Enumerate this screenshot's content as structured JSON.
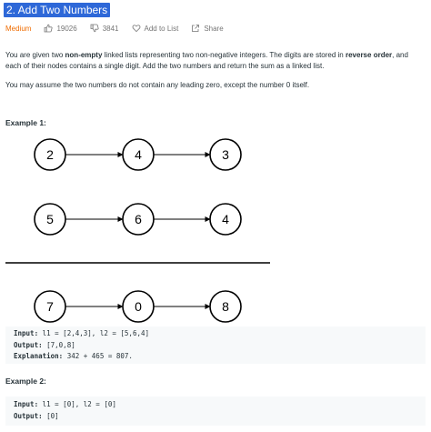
{
  "problem": {
    "title": "2. Add Two Numbers",
    "difficulty": "Medium",
    "likes": "19026",
    "dislikes": "3841",
    "add_to_list": "Add to List",
    "share": "Share"
  },
  "description": {
    "p1_before_bold1": "You are given two ",
    "p1_bold1": "non-empty",
    "p1_mid": " linked lists representing two non-negative integers. The digits are stored in ",
    "p1_bold2a": "reverse",
    "p1_bold2b": "order",
    "p1_end": ", and each of their nodes contains a single digit. Add the two numbers and return the sum as a linked list.",
    "p2": "You may assume the two numbers do not contain any leading zero, except the number 0 itself."
  },
  "example1": {
    "heading": "Example 1:",
    "list1": [
      "2",
      "4",
      "3"
    ],
    "list2": [
      "5",
      "6",
      "4"
    ],
    "result": [
      "7",
      "0",
      "8"
    ],
    "input_label": "Input:",
    "input_value": " l1 = [2,4,3], l2 = [5,6,4]",
    "output_label": "Output:",
    "output_value": " [7,0,8]",
    "explanation_label": "Explanation:",
    "explanation_value": " 342 + 465 = 807."
  },
  "example2": {
    "heading": "Example 2:",
    "input_label": "Input:",
    "input_value": " l1 = [0], l2 = [0]",
    "output_label": "Output:",
    "output_value": " [0]"
  },
  "colors": {
    "title_highlight": "#2e68d8",
    "difficulty": "#ef6c00",
    "code_bg": "#f7f9fa"
  }
}
